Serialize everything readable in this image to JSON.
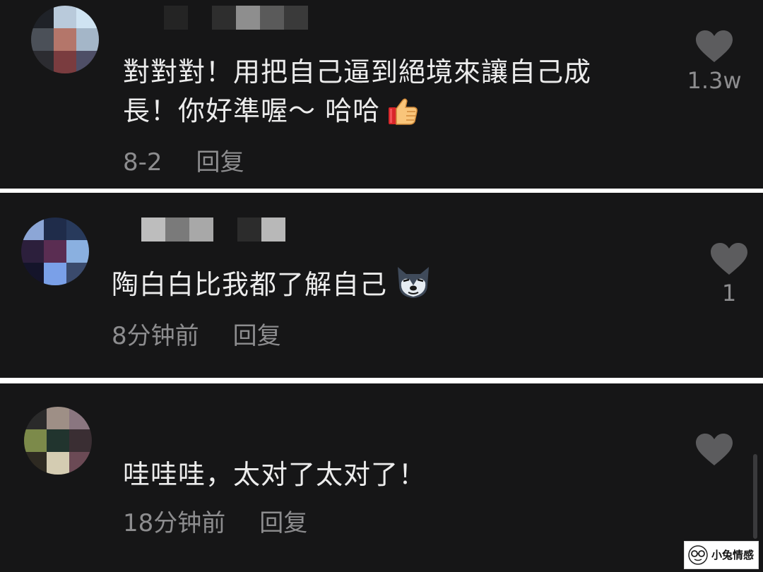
{
  "colors": {
    "background": "#161617",
    "divider": "#ffffff",
    "comment_text": "#ececec",
    "meta_text": "#8d8d8f",
    "heart_icon": "#5c5c5e"
  },
  "comments": [
    {
      "avatar": "pixelated-avatar",
      "username": "",
      "text": "對對對！用把自己逼到絕境來讓自己成\n長！你好準喔～ 哈哈",
      "emoji": "thumbs-up-emoji",
      "time": "8-2",
      "reply_label": "回复",
      "like_icon": "heart-icon",
      "like_count": "1.3w"
    },
    {
      "avatar": "pixelated-avatar",
      "username": "",
      "text": "陶白白比我都了解自己",
      "emoji": "wolf-face-emoji",
      "time": "8分钟前",
      "reply_label": "回复",
      "like_icon": "heart-icon",
      "like_count": "1"
    },
    {
      "avatar": "pixelated-avatar",
      "username": "",
      "text": "哇哇哇，太对了太对了！",
      "emoji": "",
      "time": "18分钟前",
      "reply_label": "回复",
      "like_icon": "heart-icon",
      "like_count": ""
    }
  ],
  "watermark": {
    "text": "小兔情感",
    "icon": "bespectacled-face-logo"
  }
}
